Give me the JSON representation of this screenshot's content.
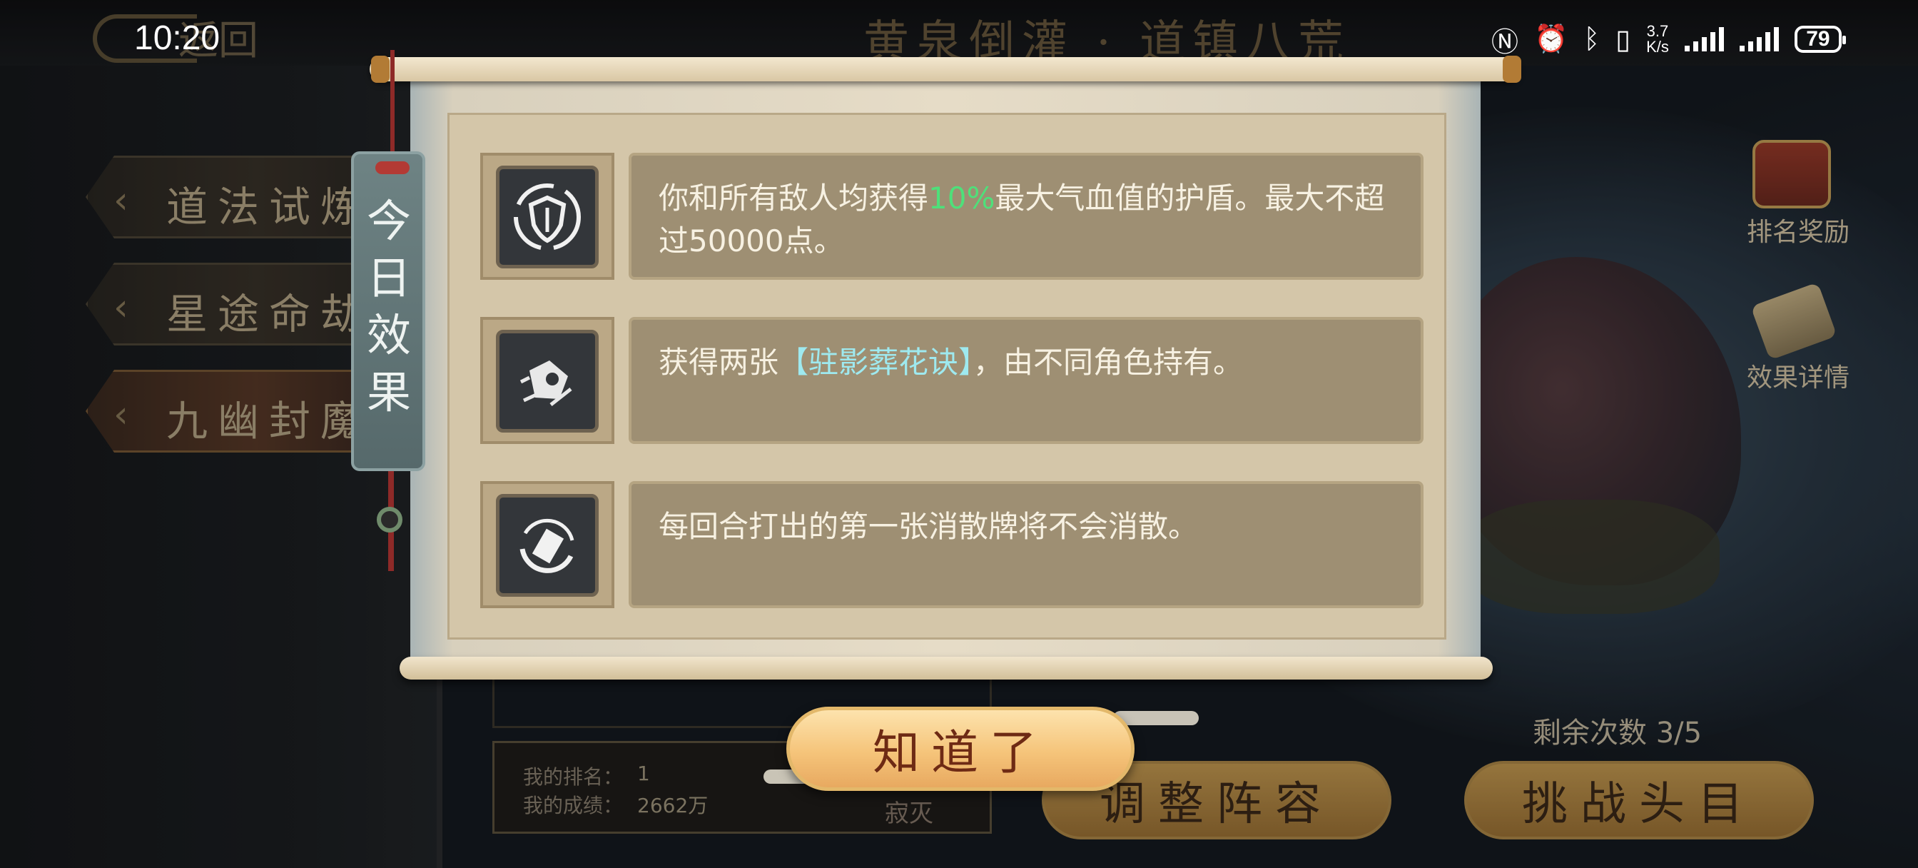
{
  "status_bar": {
    "time": "10:20",
    "net_speed_value": "3.7",
    "net_speed_unit": "K/s",
    "battery": "79",
    "icons": [
      "nfc-icon",
      "alarm-icon",
      "bluetooth-icon",
      "vibrate-icon",
      "signal-icon",
      "signal-icon"
    ]
  },
  "header": {
    "back_label": "返回",
    "stage_title": "黄泉倒灌 · 道镇八荒"
  },
  "modes": [
    {
      "label": "道法试炼",
      "active": false
    },
    {
      "label": "星途命劫",
      "active": false
    },
    {
      "label": "九幽封魔",
      "active": true
    }
  ],
  "rank_panel": {
    "rank_label": "我的排名：",
    "rank_value": "1",
    "score_label": "我的成绩：",
    "score_value": "2662万",
    "silence_label": "寂灭"
  },
  "right_panel": {
    "rank_reward_label": "排名奖励",
    "effect_detail_label": "效果详情",
    "remaining_label": "剩余次数 3/5",
    "adjust_button": "调整阵容",
    "challenge_button": "挑战头目"
  },
  "modal": {
    "tag_text": "今日效果",
    "effects": [
      {
        "icon": "shield-icon",
        "text_before": "你和所有敌人均获得",
        "highlight": "10%",
        "text_after": "最大气血值的护盾。最大不超过50000点。"
      },
      {
        "icon": "card-scatter-icon",
        "text_before": "获得两张",
        "highlight": "【驻影葬花诀】",
        "text_after": "，由不同角色持有。"
      },
      {
        "icon": "card-swirl-icon",
        "text_before": "每回合打出的第一张消散牌将不会消散。",
        "highlight": "",
        "text_after": ""
      }
    ],
    "confirm_button": "知道了"
  },
  "colors": {
    "highlight_green": "#4ee07a",
    "highlight_cyan": "#9ee9ef",
    "effect_text": "#f7f1e2",
    "button_text": "#6e2a14"
  }
}
